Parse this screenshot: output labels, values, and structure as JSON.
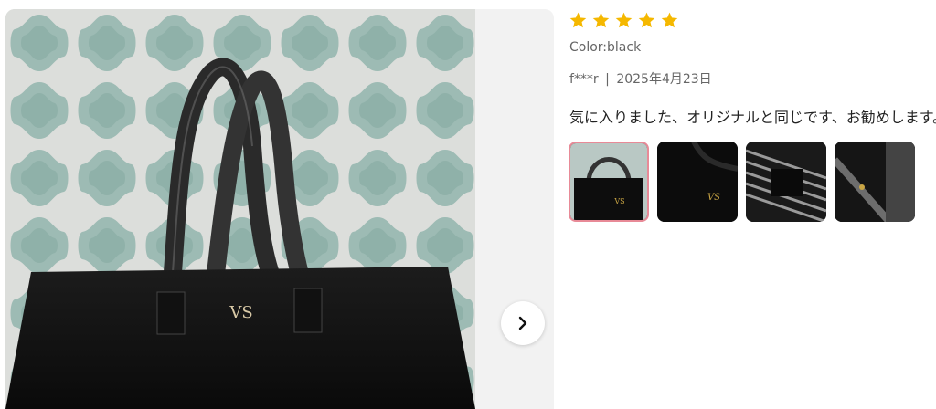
{
  "review": {
    "rating": 5,
    "max_rating": 5,
    "star_color": "#f5b800",
    "color_label": "Color:black",
    "reviewer": "f***r",
    "separator": "|",
    "date": "2025年4月23日",
    "comment": "気に入りました、オリジナルと同じです、お勧めします。"
  },
  "viewer": {
    "next_icon": "chevron-right-icon",
    "thumbnails": [
      {
        "selected": true
      },
      {
        "selected": false
      },
      {
        "selected": false
      },
      {
        "selected": false
      }
    ]
  }
}
